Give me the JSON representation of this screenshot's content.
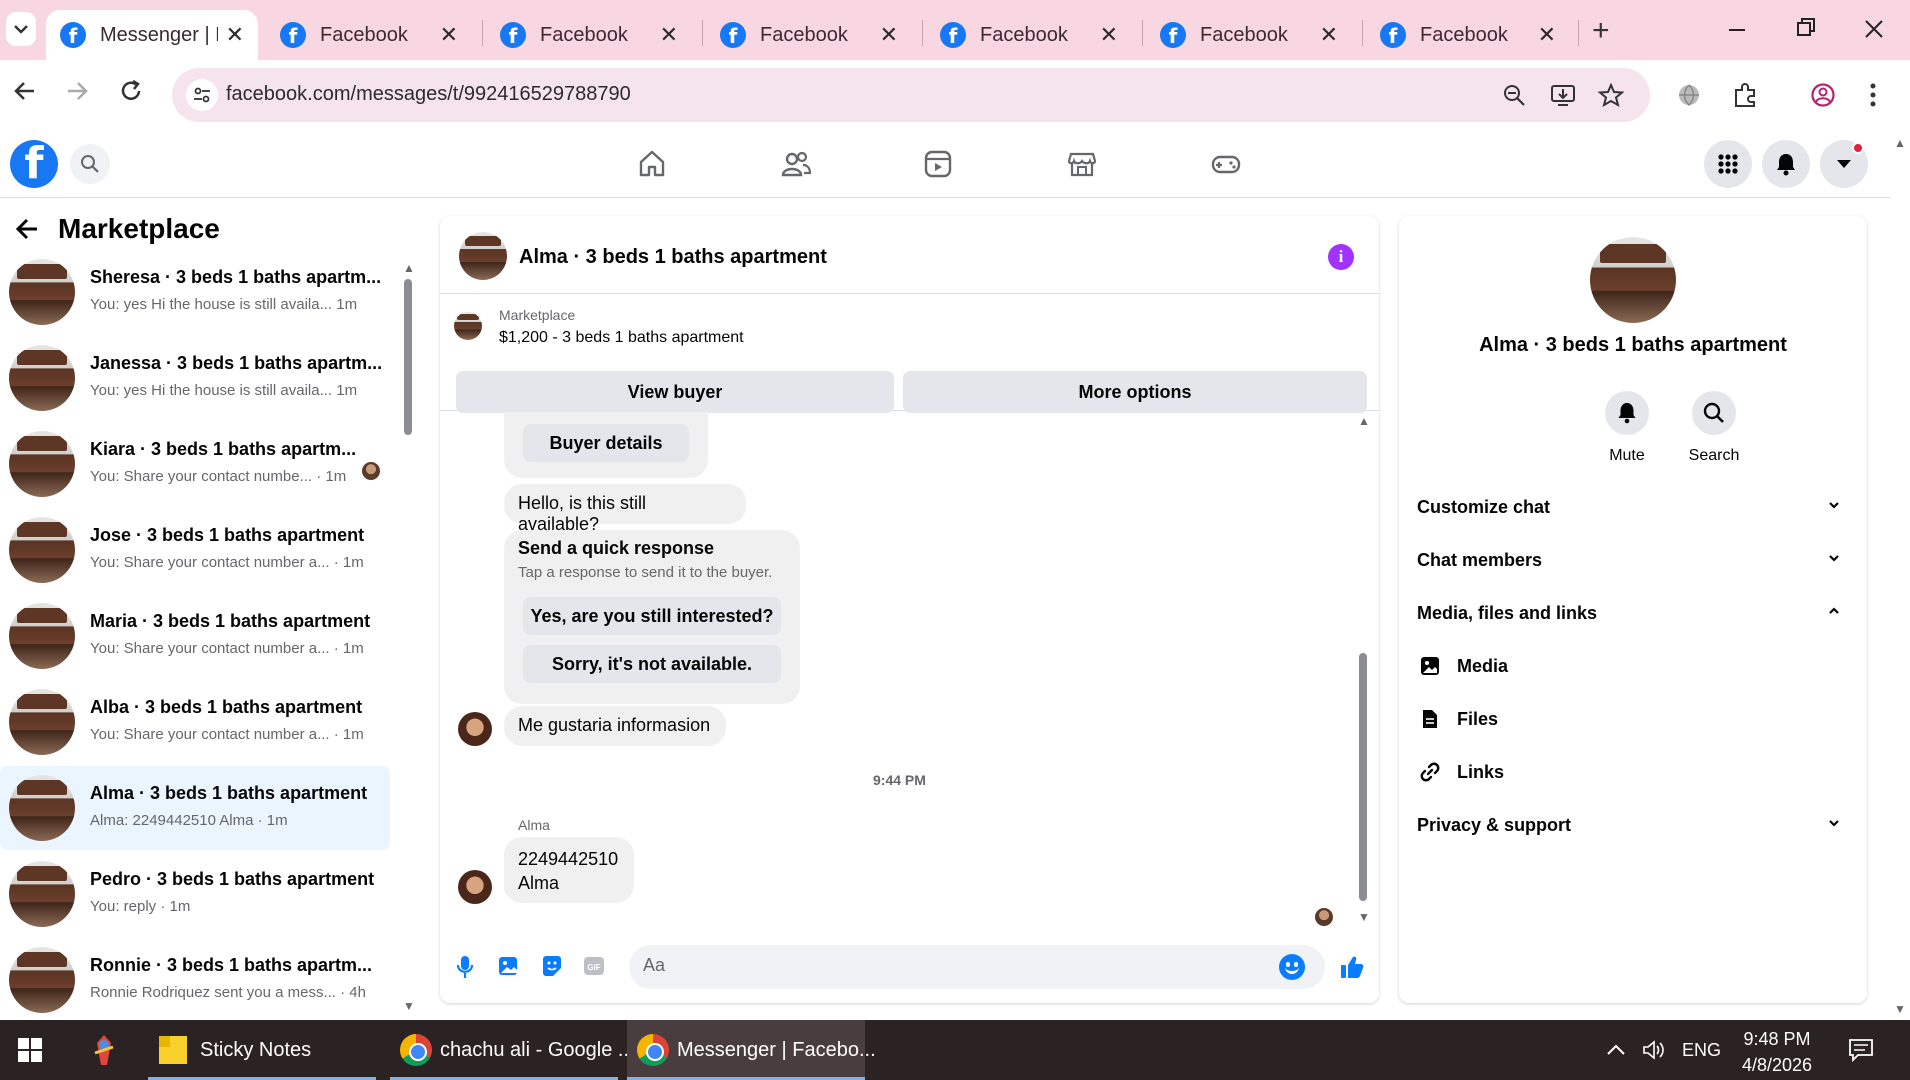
{
  "browser": {
    "tabs": [
      {
        "title": "Messenger | Fa",
        "active": true
      },
      {
        "title": "Facebook"
      },
      {
        "title": "Facebook"
      },
      {
        "title": "Facebook"
      },
      {
        "title": "Facebook"
      },
      {
        "title": "Facebook"
      },
      {
        "title": "Facebook"
      }
    ],
    "url": "facebook.com/messages/t/992416529788790"
  },
  "left_panel": {
    "title": "Marketplace",
    "conversations": [
      {
        "name": "Sheresa · 3 beds 1 baths apartm...",
        "preview": "You: yes Hi the house is still availa... 1m"
      },
      {
        "name": "Janessa · 3 beds 1 baths apartm...",
        "preview": "You: yes Hi the house is still availa... 1m"
      },
      {
        "name": "Kiara · 3 beds 1 baths apartm...",
        "preview": "You: Share your contact numbe... · 1m"
      },
      {
        "name": "Jose · 3 beds 1 baths apartment",
        "preview": "You: Share your contact number a... · 1m"
      },
      {
        "name": "Maria · 3 beds 1 baths apartment",
        "preview": "You: Share your contact number a... · 1m"
      },
      {
        "name": "Alba · 3 beds 1 baths apartment",
        "preview": "You: Share your contact number a... · 1m"
      },
      {
        "name": "Alma · 3 beds 1 baths apartment",
        "preview": "Alma: 2249442510 Alma · 1m",
        "selected": true
      },
      {
        "name": "Pedro · 3 beds 1 baths apartment",
        "preview": "You: reply · 1m"
      },
      {
        "name": "Ronnie · 3 beds 1 baths apartm...",
        "preview": "Ronnie Rodriquez sent you a mess... · 4h"
      }
    ]
  },
  "chat": {
    "title": "Alma · 3 beds 1 baths apartment",
    "marketplace_label": "Marketplace",
    "listing": "$1,200 - 3 beds 1 baths apartment",
    "view_buyer": "View buyer",
    "more_options": "More options",
    "buyer_details": "Buyer details",
    "msg_available": "Hello, is this still available?",
    "quick_title": "Send a quick response",
    "quick_sub": "Tap a response to send it to the buyer.",
    "quick_opt1": "Yes, are you still interested?",
    "quick_opt2": "Sorry, it's not available.",
    "msg_info": "Me gustaria informasion",
    "timestamp": "9:44 PM",
    "sender": "Alma",
    "msg_phone_line1": "2249442510",
    "msg_phone_line2": "Alma",
    "composer_placeholder": "Aa"
  },
  "right_panel": {
    "title": "Alma · 3 beds 1 baths apartment",
    "mute": "Mute",
    "search": "Search",
    "customize": "Customize chat",
    "members": "Chat members",
    "media_section": "Media, files and links",
    "media": "Media",
    "files": "Files",
    "links": "Links",
    "privacy": "Privacy & support"
  },
  "taskbar": {
    "sticky": "Sticky Notes",
    "chrome1": "chachu ali - Google ...",
    "chrome2": "Messenger | Facebo...",
    "lang": "ENG",
    "time": "9:48 PM",
    "date": "4/8/2026"
  },
  "colors": {
    "facebook_blue": "#1877f2",
    "messenger_blue": "#0a7cff",
    "info_purple": "#a033ff",
    "selected_row": "#ebf5ff",
    "tab_strip": "#f8d7e3"
  }
}
